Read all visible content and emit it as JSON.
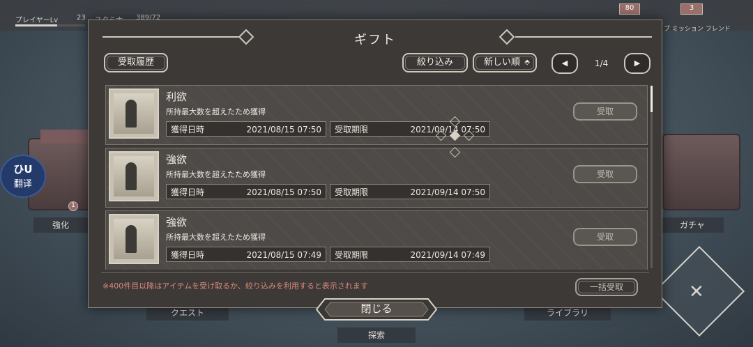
{
  "hud": {
    "player_lv_label": "プレイヤーLv",
    "player_lv": "23",
    "stamina_label": "スタミナ",
    "stamina": "389/72",
    "badge_1": "80",
    "badge_2": "3",
    "right_menu": "ブ ミッション フレンド"
  },
  "background": {
    "strengthen": "強化",
    "gacha": "ガチャ",
    "quest": "クエスト",
    "library": "ライブラリ",
    "explore": "探索",
    "small_badge": "1"
  },
  "translate": {
    "icon": "ひU",
    "label": "翻译"
  },
  "modal": {
    "title": "ギフト",
    "history_btn": "受取履歴",
    "filter_btn": "絞り込み",
    "sort_btn": "新しい順",
    "sort_icon": "⬘",
    "prev_icon": "◀",
    "next_icon": "▶",
    "page": "1/4",
    "notice": "※400件目以降はアイテムを受け取るか、絞り込みを利用すると表示されます",
    "bulk_btn": "一括受取",
    "close_btn": "閉じる"
  },
  "gifts": [
    {
      "name": "利欲",
      "reason": "所持最大数を超えたため獲得",
      "acquired_label": "獲得日時",
      "acquired": "2021/08/15 07:50",
      "expiry_label": "受取期限",
      "expiry": "2021/09/14 07:50",
      "receive": "受取"
    },
    {
      "name": "強欲",
      "reason": "所持最大数を超えたため獲得",
      "acquired_label": "獲得日時",
      "acquired": "2021/08/15 07:50",
      "expiry_label": "受取期限",
      "expiry": "2021/09/14 07:50",
      "receive": "受取"
    },
    {
      "name": "強欲",
      "reason": "所持最大数を超えたため獲得",
      "acquired_label": "獲得日時",
      "acquired": "2021/08/15 07:49",
      "expiry_label": "受取期限",
      "expiry": "2021/09/14 07:49",
      "receive": "受取"
    }
  ],
  "colors": {
    "accent": "#d0cabe",
    "notice": "#d98a7a",
    "panel": "#3c3937"
  }
}
